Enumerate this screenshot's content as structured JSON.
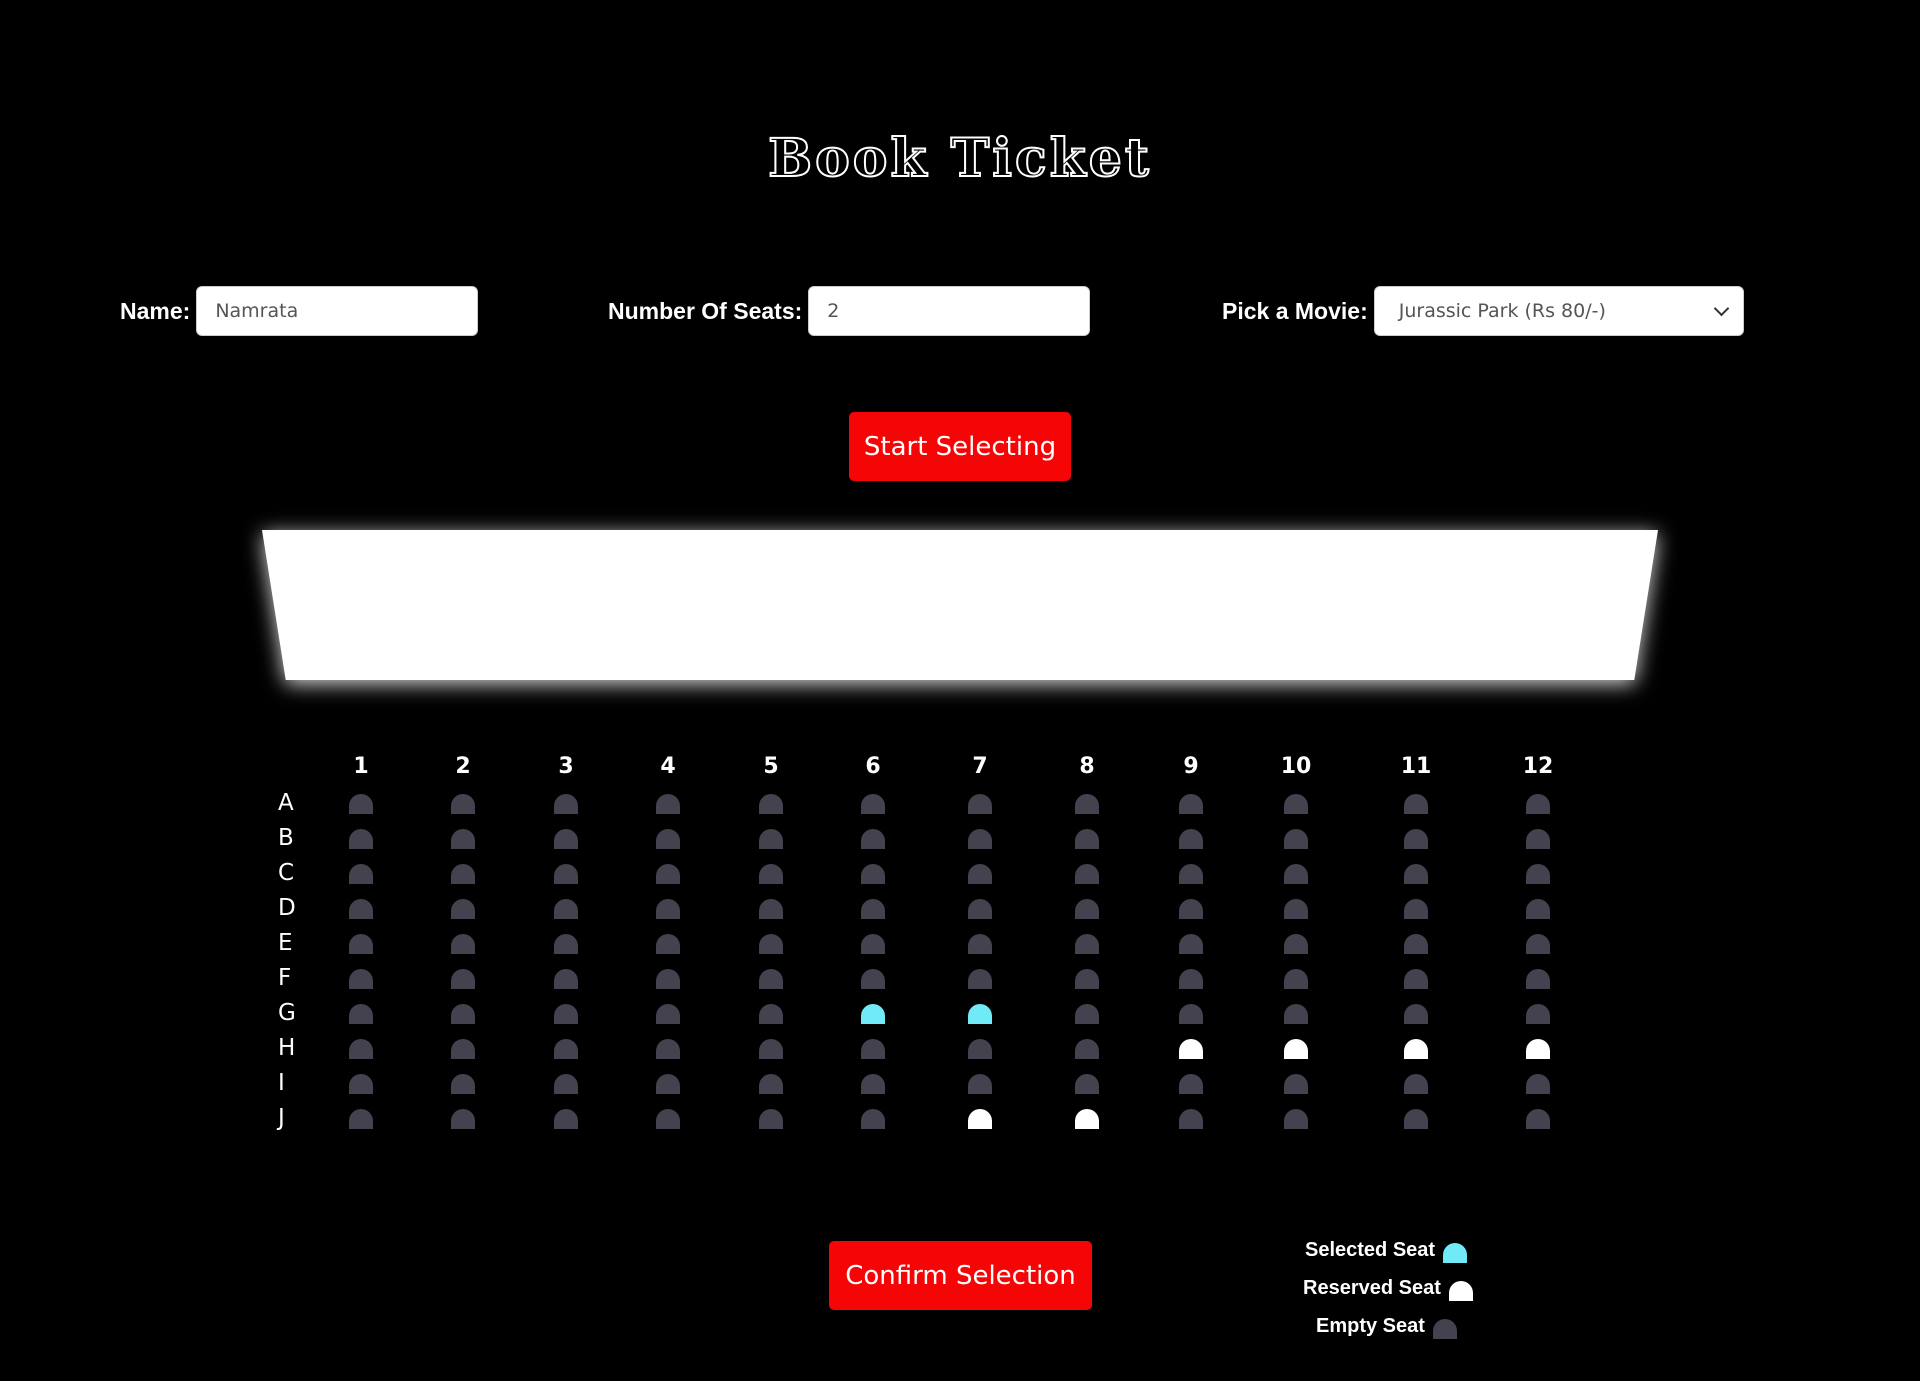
{
  "title": "Book Ticket",
  "form": {
    "name_label": "Name:",
    "name_value": "Namrata",
    "seats_label": "Number Of Seats:",
    "seats_value": "2",
    "movie_label": "Pick a Movie:",
    "movie_selected": "Jurassic Park (Rs 80/-)"
  },
  "buttons": {
    "start": "Start Selecting",
    "confirm": "Confirm Selection"
  },
  "seat_map": {
    "columns": [
      "1",
      "2",
      "3",
      "4",
      "5",
      "6",
      "7",
      "8",
      "9",
      "10",
      "11",
      "12"
    ],
    "rows": [
      "A",
      "B",
      "C",
      "D",
      "E",
      "F",
      "G",
      "H",
      "I",
      "J"
    ],
    "selected": [
      "G6",
      "G7"
    ],
    "reserved": [
      "H9",
      "H10",
      "H11",
      "H12",
      "J7",
      "J8"
    ]
  },
  "legend": {
    "selected": "Selected Seat",
    "reserved": "Reserved Seat",
    "empty": "Empty Seat"
  },
  "colors": {
    "accent_red": "#f50505",
    "seat_empty": "#44424f",
    "seat_selected": "#6feaf6",
    "seat_reserved": "#ffffff"
  }
}
